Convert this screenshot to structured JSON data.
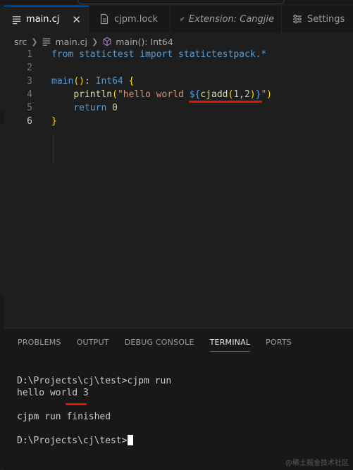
{
  "tabs": [
    {
      "label": "main.cj",
      "icon": "list-icon",
      "active": true,
      "close": "✕"
    },
    {
      "label": "cjpm.lock",
      "icon": "file-icon",
      "active": false
    },
    {
      "label": "Extension: Cangjie",
      "icon": "extensions-icon",
      "active": false
    },
    {
      "label": "Settings",
      "icon": "settings-icon",
      "active": false
    }
  ],
  "breadcrumb": {
    "folder": "src",
    "file": "main.cj",
    "symbol": "main(): Int64"
  },
  "editor": {
    "current_line": 6,
    "lines": [
      {
        "n": "1",
        "tokens": [
          {
            "t": "from",
            "c": "kw"
          },
          {
            "t": " ",
            "c": "plain"
          },
          {
            "t": "statictest",
            "c": "kw"
          },
          {
            "t": " ",
            "c": "plain"
          },
          {
            "t": "import",
            "c": "kw"
          },
          {
            "t": " ",
            "c": "plain"
          },
          {
            "t": "statictestpack.*",
            "c": "kw"
          }
        ]
      },
      {
        "n": "2",
        "tokens": []
      },
      {
        "n": "3",
        "tokens": [
          {
            "t": "main",
            "c": "kw"
          },
          {
            "t": "()",
            "c": "punc"
          },
          {
            "t": ": ",
            "c": "plain"
          },
          {
            "t": "Int64",
            "c": "kw"
          },
          {
            "t": " ",
            "c": "plain"
          },
          {
            "t": "{",
            "c": "punc"
          }
        ]
      },
      {
        "n": "4",
        "tokens": [
          {
            "t": "    ",
            "c": "plain"
          },
          {
            "t": "println",
            "c": "fn"
          },
          {
            "t": "(",
            "c": "punc"
          },
          {
            "t": "\"hello world ",
            "c": "str"
          },
          {
            "t": "${",
            "c": "dollar"
          },
          {
            "t": "cjadd",
            "c": "fn"
          },
          {
            "t": "(",
            "c": "punc"
          },
          {
            "t": "1",
            "c": "num"
          },
          {
            "t": ",",
            "c": "plain"
          },
          {
            "t": "2",
            "c": "num"
          },
          {
            "t": ")",
            "c": "punc"
          },
          {
            "t": "}",
            "c": "dollar"
          },
          {
            "t": "\"",
            "c": "str"
          },
          {
            "t": ")",
            "c": "punc"
          }
        ]
      },
      {
        "n": "5",
        "tokens": [
          {
            "t": "    ",
            "c": "plain"
          },
          {
            "t": "return",
            "c": "kw"
          },
          {
            "t": " ",
            "c": "plain"
          },
          {
            "t": "0",
            "c": "num"
          }
        ]
      },
      {
        "n": "6",
        "tokens": [
          {
            "t": "}",
            "c": "punc"
          }
        ]
      }
    ]
  },
  "panel": {
    "tabs": [
      "PROBLEMS",
      "OUTPUT",
      "DEBUG CONSOLE",
      "TERMINAL",
      "PORTS"
    ],
    "active_tab": "TERMINAL",
    "terminal_lines": [
      "D:\\Projects\\cj\\test>cjpm run",
      "hello world 3",
      "",
      "cjpm run finished",
      "",
      "D:\\Projects\\cj\\test>"
    ]
  },
  "watermark": "@稀土掘金技术社区",
  "colors": {
    "accent": "#0078d4",
    "annotation_underline": "#e51400",
    "background": "#1e1e1e"
  }
}
